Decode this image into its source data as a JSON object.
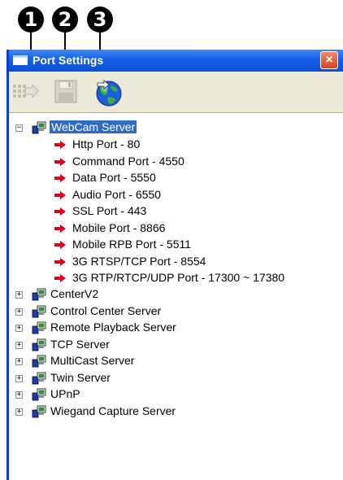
{
  "callouts": [
    "1",
    "2",
    "3"
  ],
  "window": {
    "title": "Port Settings",
    "close_label": "×"
  },
  "toolbar": {
    "buttons": [
      {
        "name": "connect",
        "state": "disabled"
      },
      {
        "name": "save",
        "state": "disabled"
      },
      {
        "name": "globe",
        "state": "enabled"
      }
    ]
  },
  "tree": {
    "expanded": {
      "label": "WebCam Server",
      "expander": "−",
      "ports": [
        "Http Port - 80",
        "Command Port - 4550",
        "Data Port - 5550",
        "Audio Port - 6550",
        "SSL Port - 443",
        "Mobile Port - 8866",
        "Mobile RPB Port - 5511",
        "3G RTSP/TCP Port - 8554",
        "3G RTP/RTCP/UDP Port - 17300 ~ 17380"
      ]
    },
    "collapsed_expander": "+",
    "servers": [
      "CenterV2",
      "Control Center Server",
      "Remote Playback Server",
      "TCP Server",
      "MultiCast Server",
      "Twin Server",
      "UPnP",
      "Wiegand Capture Server"
    ]
  },
  "colors": {
    "titlebar": "#1460e6",
    "selection": "#316ac5",
    "arrow": "#e0001a",
    "toolbar_bg": "#ece9d8"
  }
}
